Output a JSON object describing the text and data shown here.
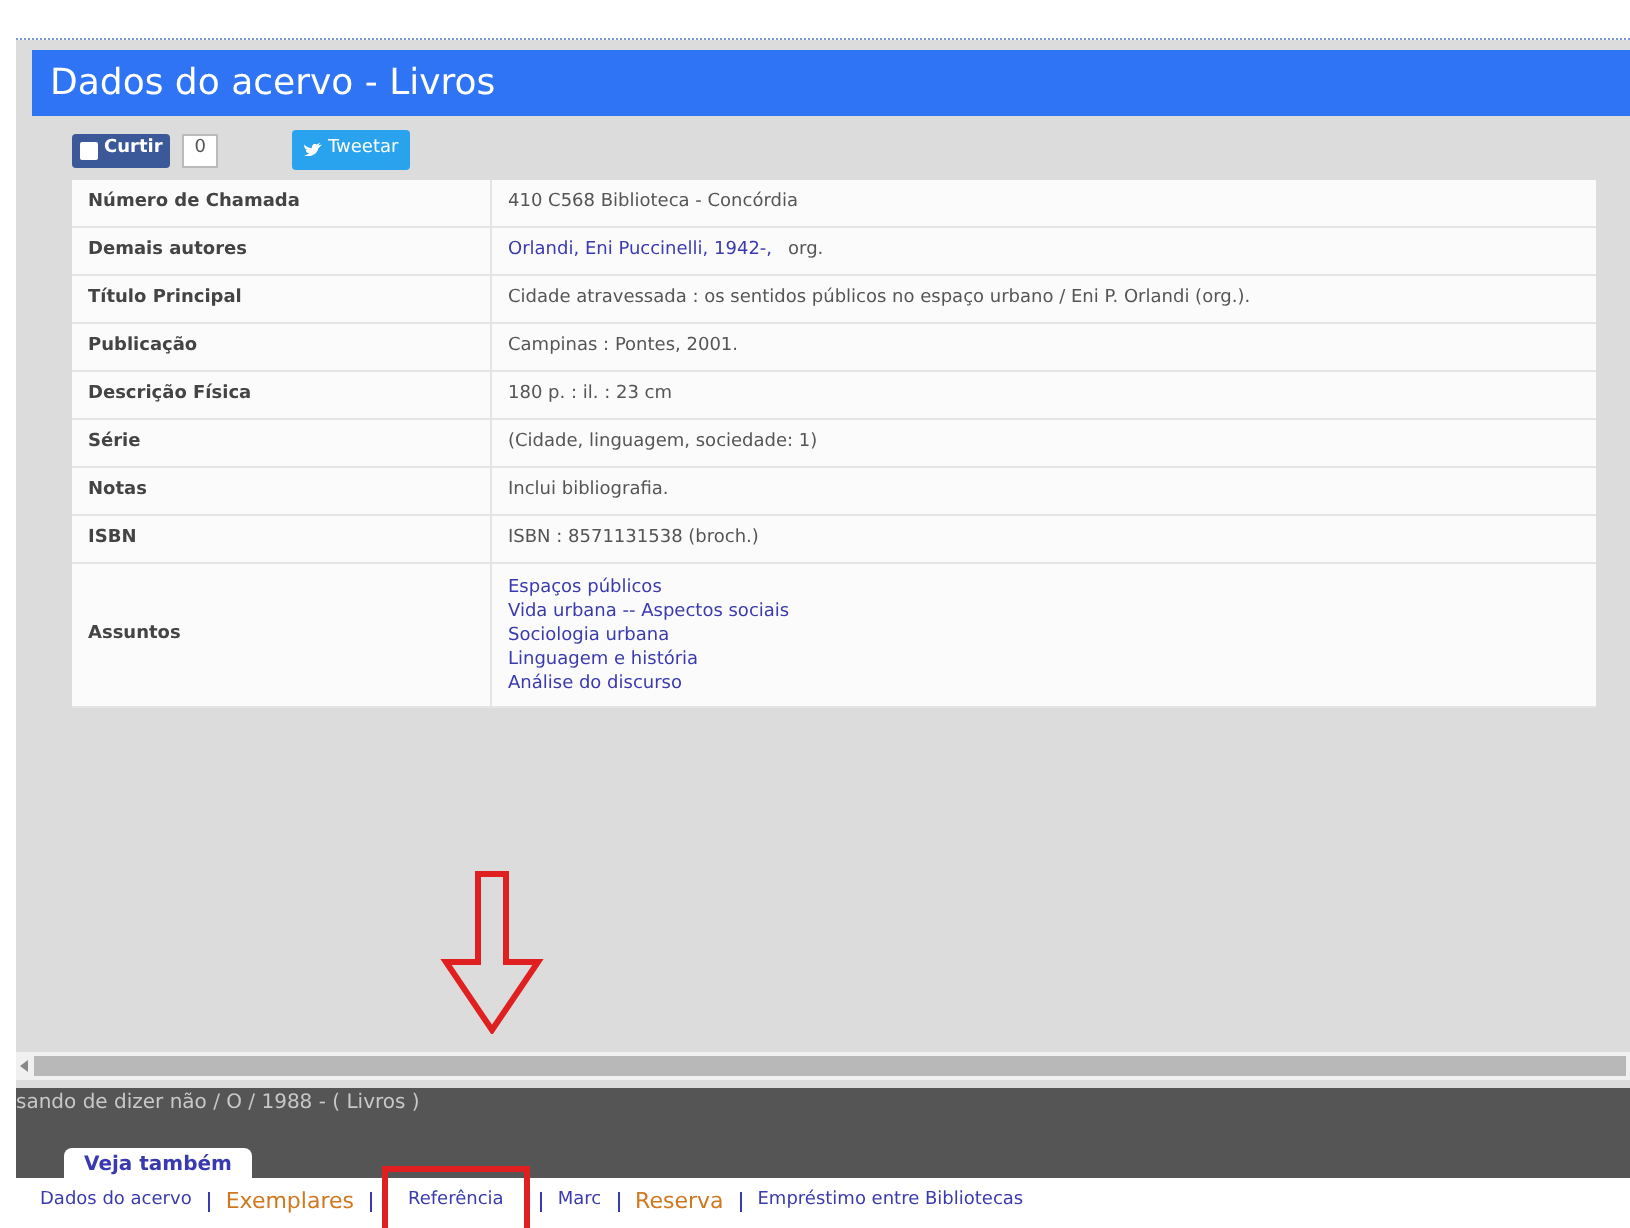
{
  "dialog": {
    "title": "Dados do acervo - Livros",
    "like_button": "Curtir",
    "like_count": "0",
    "tweet_button": "Tweetar"
  },
  "record": [
    {
      "label": "Número de Chamada",
      "kind": "text",
      "value": "410  C568  Biblioteca - Concórdia"
    },
    {
      "label": "Demais autores",
      "kind": "link",
      "value": "Orlandi, Eni Puccinelli,  1942-,",
      "suffix": "org."
    },
    {
      "label": "Título Principal",
      "kind": "text",
      "value": "Cidade atravessada :   os sentidos públicos no espaço urbano /   Eni P. Orlandi (org.)."
    },
    {
      "label": "Publicação",
      "kind": "text",
      "value": "Campinas :   Pontes,   2001."
    },
    {
      "label": "Descrição Física",
      "kind": "text",
      "value": "180 p. :   il. :   23 cm"
    },
    {
      "label": "Série",
      "kind": "text",
      "value": "(Cidade, linguagem, sociedade:   1)"
    },
    {
      "label": "Notas",
      "kind": "text",
      "value": "Inclui bibliografia."
    },
    {
      "label": "ISBN",
      "kind": "text",
      "value": "ISBN : 8571131538 (broch.)"
    },
    {
      "label": "Assuntos",
      "kind": "links",
      "items": [
        "Espaços públicos",
        "Vida urbana --   Aspectos sociais",
        "Sociologia urbana",
        "Linguagem e história",
        "Análise do discurso"
      ]
    }
  ],
  "background_line": "sando de dizer não / O / 1988 - ( Livros )",
  "see_also": {
    "tab": "Veja também",
    "links": [
      {
        "label": "Dados do acervo",
        "emphasis": false,
        "annotated": false
      },
      {
        "label": "Exemplares",
        "emphasis": true,
        "annotated": false
      },
      {
        "label": "Referência",
        "emphasis": false,
        "annotated": true
      },
      {
        "label": "Marc",
        "emphasis": false,
        "annotated": false
      },
      {
        "label": "Reserva",
        "emphasis": true,
        "annotated": false
      },
      {
        "label": "Empréstimo entre Bibliotecas",
        "emphasis": false,
        "annotated": false
      }
    ]
  }
}
